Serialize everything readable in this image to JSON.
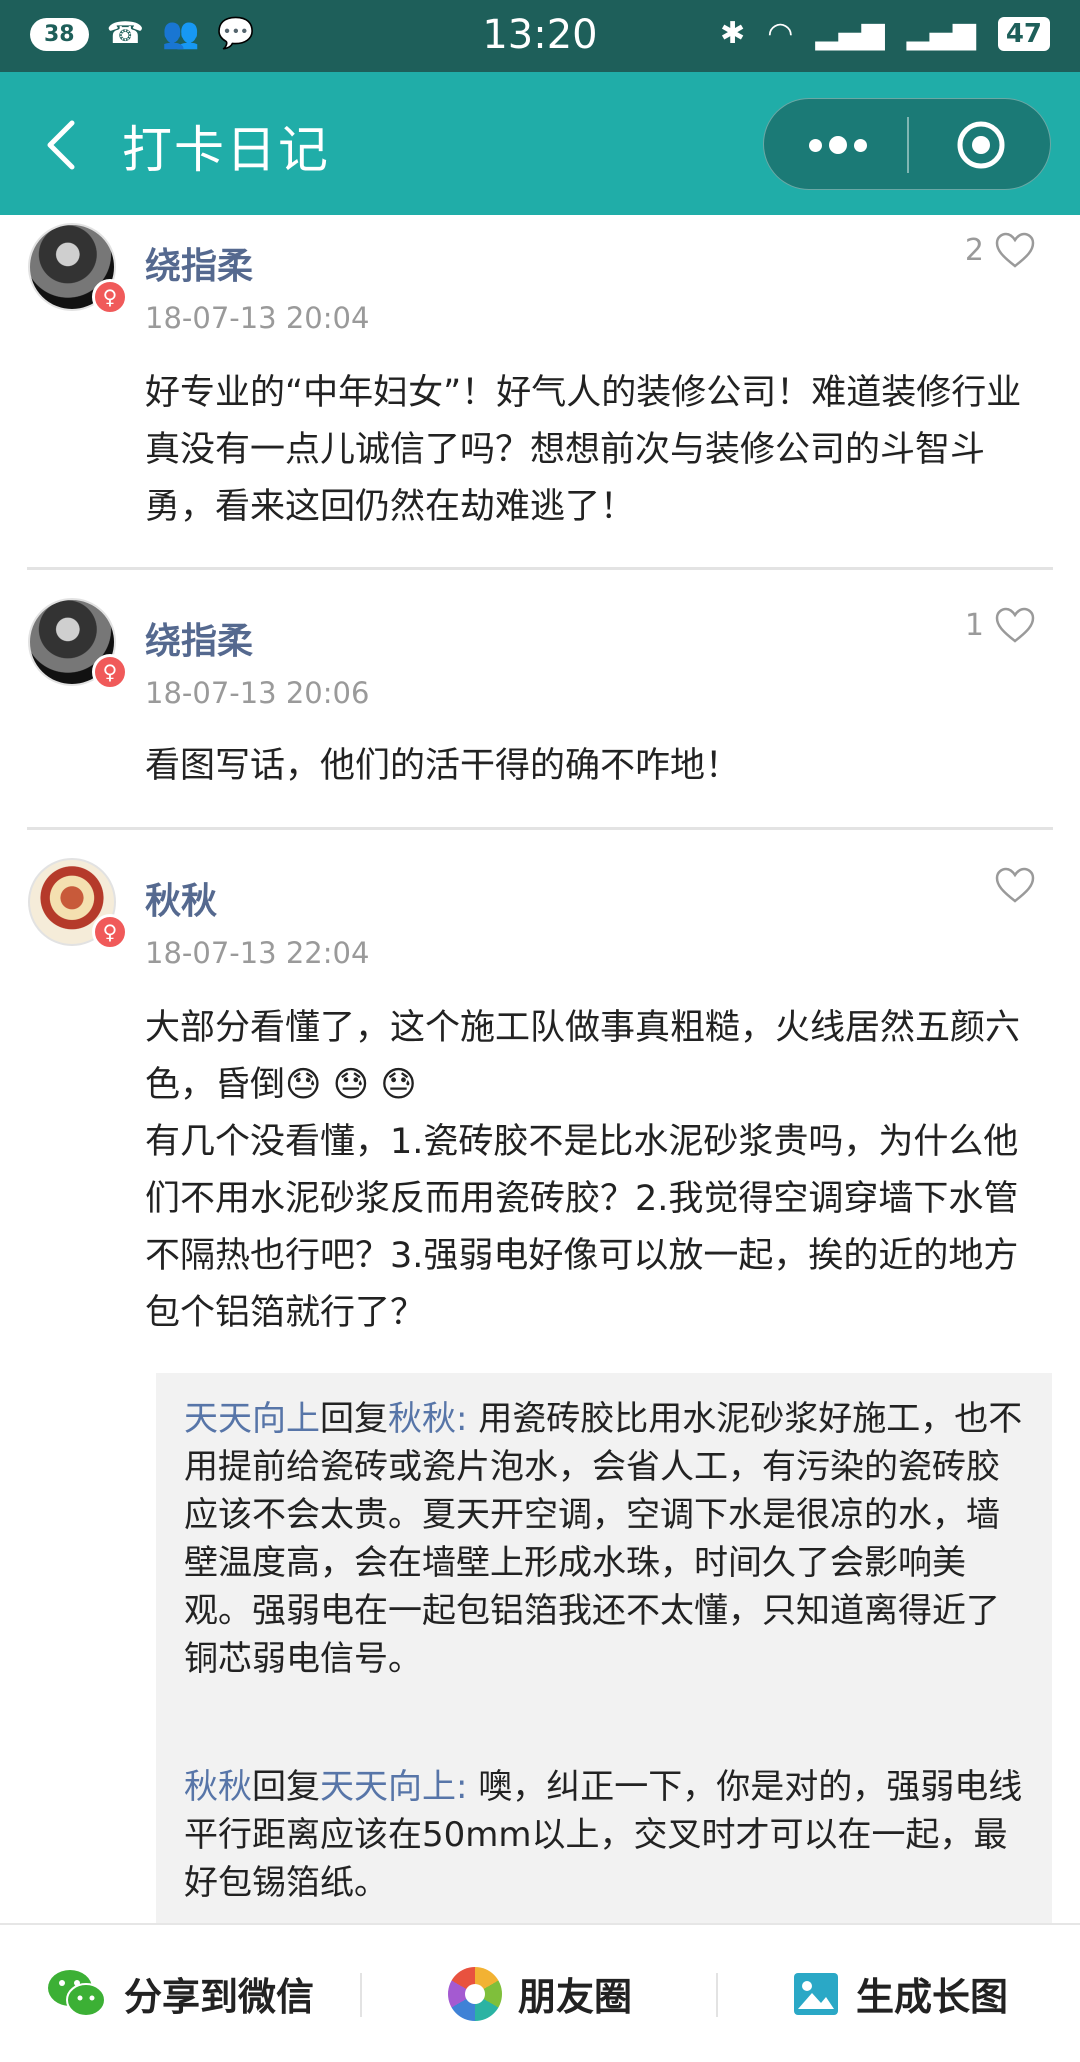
{
  "status_bar": {
    "notification_count": "38",
    "time": "13:20",
    "battery": "47",
    "colors": {
      "background": "#1e5f5a"
    }
  },
  "title_bar": {
    "title": "打卡日记",
    "colors": {
      "background": "#20ada8"
    }
  },
  "comments": [
    {
      "name": "绕指柔",
      "time": "18-07-13 20:04",
      "likes": "2",
      "text": "好专业的“中年妇女”！好气人的装修公司！难道装修行业真没有一点儿诚信了吗？想想前次与装修公司的斗智斗勇，看来这回仍然在劫难逃了！"
    },
    {
      "name": "绕指柔",
      "time": "18-07-13 20:06",
      "likes": "1",
      "text": "看图写话，他们的活干得的确不咋地！"
    },
    {
      "name": "秋秋",
      "time": "18-07-13 22:04",
      "likes": "",
      "text_line1": "大部分看懂了，这个施工队做事真粗糙，火线居然五颜六色，昏倒😓 😓 😓",
      "text_line2": "有几个没看懂，1.瓷砖胶不是比水泥砂浆贵吗，为什么他们不用水泥砂浆反而用瓷砖胶？2.我觉得空调穿墙下水管不隔热也行吧？3.强弱电好像可以放一起，挨的近的地方包个铝箔就行了？"
    }
  ],
  "replies": [
    {
      "from": "天天向上",
      "reply_word": "回复",
      "to": "秋秋:",
      "text": " 用瓷砖胶比用水泥砂浆好施工，也不用提前给瓷砖或瓷片泡水，会省人工，有污染的瓷砖胶应该不会太贵。夏天开空调，空调下水是很凉的水，墙壁温度高，会在墙壁上形成水珠，时间久了会影响美观。强弱电在一起包铝箔我还不太懂，只知道离得近了铜芯弱电信号。"
    },
    {
      "from": "秋秋",
      "reply_word": "回复",
      "to": "天天向上:",
      "text": " 噢，纠正一下，你是对的，强弱电线平行距离应该在50mm以上，交叉时才可以在一起，最好包锡箔纸。"
    }
  ],
  "bottom_bar": {
    "share_wechat": "分享到微信",
    "moments": "朋友圈",
    "long_image": "生成长图"
  },
  "icons": [
    "back-arrow-icon",
    "more-icon",
    "target-icon",
    "heart-icon",
    "female-icon",
    "wechat-icon",
    "moments-icon",
    "image-icon"
  ],
  "accent_name_color": "#55698f",
  "reply_name_color": "#5775a8"
}
